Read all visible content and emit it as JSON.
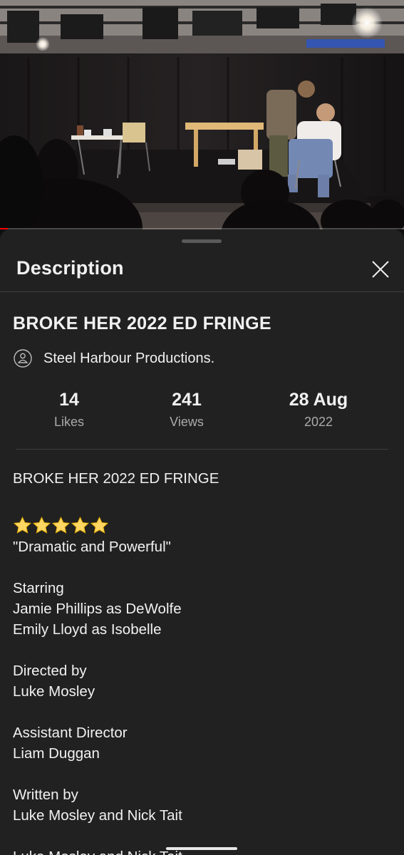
{
  "video": {
    "progress_fraction": 0.02
  },
  "sheet": {
    "title": "Description",
    "close_icon": "close-icon"
  },
  "video_title": "BROKE HER 2022 ED FRINGE",
  "channel": {
    "name": "Steel Harbour Productions.",
    "icon": "channel-avatar-icon"
  },
  "stats": [
    {
      "value": "14",
      "label": "Likes"
    },
    {
      "value": "241",
      "label": "Views"
    },
    {
      "value": "28 Aug",
      "label": "2022"
    }
  ],
  "description": {
    "headline": "BROKE HER 2022 ED FRINGE",
    "rating_stars": 5,
    "rating_icon": "star-icon",
    "rating_color": "#fdd663",
    "quote": "\"Dramatic and Powerful\"",
    "starring_heading": "Starring",
    "starring": [
      "Jamie Phillips as DeWolfe",
      "Emily Lloyd as Isobelle"
    ],
    "directed_heading": "Directed by",
    "directed": "Luke Mosley",
    "assistant_heading": "Assistant Director",
    "assistant": "Liam Duggan",
    "written_heading": "Written by",
    "written": "Luke Mosley and Nick Tait",
    "cutoff_line": "Luke Mosley and Nick Tait"
  },
  "colors": {
    "sheet_bg": "#212121",
    "text": "#f1f1f1",
    "secondary_text": "#aaaaaa",
    "progress": "#ff0000"
  }
}
